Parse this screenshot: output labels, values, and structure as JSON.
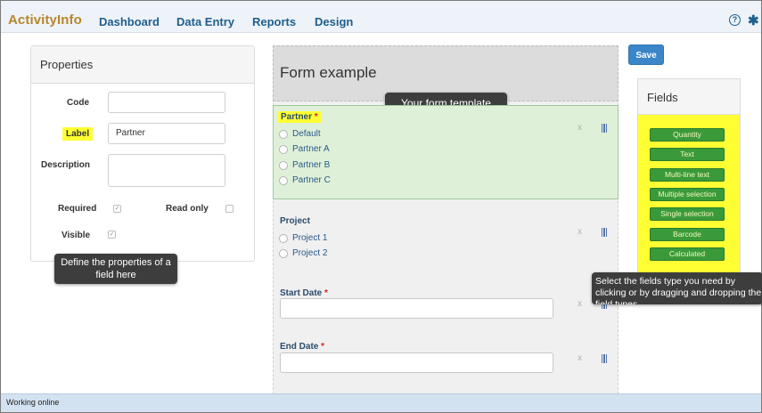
{
  "app": {
    "brand": "ActivityInfo",
    "nav": [
      "Dashboard",
      "Data Entry",
      "Reports",
      "Design"
    ],
    "help_icon": "?",
    "settings_icon": "✱"
  },
  "properties": {
    "title": "Properties",
    "code_label": "Code",
    "code_value": "",
    "label_label": "Label",
    "label_value": "Partner",
    "description_label": "Description",
    "description_value": "",
    "required_label": "Required",
    "read_only_label": "Read only",
    "visible_label": "Visible",
    "required_checked": true,
    "read_only_checked": false,
    "visible_checked": true,
    "check_mark": "✓"
  },
  "tooltips": {
    "properties": "Define the properties of a field here",
    "template": "Your form template",
    "fields": "Select the fields type you need by clicking or by dragging and dropping the field types"
  },
  "form": {
    "title": "Form example",
    "remove_glyph": "x",
    "fields": [
      {
        "label": "Partner",
        "required": "*",
        "options": [
          "Default",
          "Partner A",
          "Partner B",
          "Partner C"
        ]
      },
      {
        "label": "Project",
        "required": "",
        "options": [
          "Project 1",
          "Project 2"
        ]
      },
      {
        "label": "Start Date",
        "required": "*",
        "value": ""
      },
      {
        "label": "End Date",
        "required": "*",
        "value": ""
      }
    ]
  },
  "toolbar": {
    "save_label": "Save"
  },
  "fields_panel": {
    "title": "Fields",
    "items": [
      "Quantity",
      "Text",
      "Multi-line text",
      "Multiple selection",
      "Single selection",
      "Barcode",
      "Calculated"
    ]
  },
  "status": {
    "text": "Working online"
  },
  "colors": {
    "brand": "#b8862c",
    "nav": "#1f5e8c",
    "highlight": "#ffff33",
    "selected_field": "#dff0d8",
    "field_type_button": "#3a9a3a",
    "save_button": "#3b86c9"
  }
}
